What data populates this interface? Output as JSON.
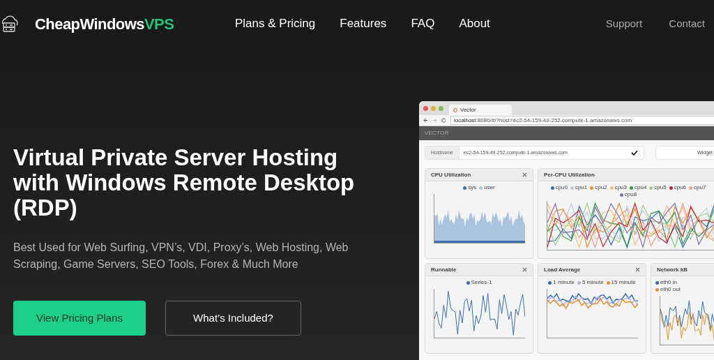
{
  "nav": {
    "logo": {
      "text": "CheapWindows",
      "accent": "VPS"
    },
    "links": [
      {
        "label": "Plans & Pricing"
      },
      {
        "label": "Features"
      },
      {
        "label": "FAQ"
      },
      {
        "label": "About"
      }
    ],
    "right_links": [
      {
        "label": "Support"
      },
      {
        "label": "Contact"
      }
    ]
  },
  "hero": {
    "title": "Virtual Private Server Hosting with Windows Remote Desktop (RDP)",
    "subtitle": "Best Used for Web Surfing, VPN’s, VDI, Proxy’s, Web Hosting, Web Scraping, Game Servers, SEO Tools, Forex & Much More",
    "buttons": [
      {
        "label": "View Pricing Plans",
        "kind": "primary"
      },
      {
        "label": "What’s Included?",
        "kind": "outline"
      }
    ]
  },
  "preview": {
    "tab_title": "Vector",
    "url_host": "localhost",
    "url_rest": ":8080/#/?host=ec2-54-159-49-252.compute-1.amazonaws.com",
    "app_title": "VECTOR",
    "hostname_label": "Hostname",
    "hostname_value": "ec2-54-159-49-252.compute-1.amazonaws.com",
    "widget_button": "Widget",
    "rows": [
      [
        {
          "title": "CPU Utilization",
          "kind": "area",
          "closable": true,
          "legend": [
            {
              "name": "sys",
              "color": "#3b6fb0"
            },
            {
              "name": "user",
              "color": "#a9c3e0"
            }
          ]
        },
        {
          "title": "Per-CPU Utilization",
          "kind": "multi",
          "legend": [
            {
              "name": "cpu0",
              "color": "#2f6db5"
            },
            {
              "name": "cpu1",
              "color": "#b9cde6"
            },
            {
              "name": "cpu2",
              "color": "#e8902a"
            },
            {
              "name": "cpu3",
              "color": "#f2c17c"
            },
            {
              "name": "cpu4",
              "color": "#2e9a3e"
            },
            {
              "name": "cpu5",
              "color": "#9fd08a"
            },
            {
              "name": "cpu6",
              "color": "#c0272d"
            },
            {
              "name": "cpu7",
              "color": "#f2a08a"
            },
            {
              "name": "cpu8",
              "color": "#8b6bb8"
            }
          ]
        }
      ],
      [
        {
          "title": "Runnable",
          "kind": "spiky",
          "closable": true,
          "legend": [
            {
              "name": "Series-1",
              "color": "#3b6fb0"
            }
          ]
        },
        {
          "title": "Load Average",
          "kind": "load",
          "closable": true,
          "legend": [
            {
              "name": "1 minute",
              "color": "#2f6db5"
            },
            {
              "name": "5 minute",
              "color": "#b6b3e6"
            },
            {
              "name": "15 minute",
              "color": "#e8902a"
            }
          ]
        },
        {
          "title": "Network kB",
          "kind": "net",
          "legend": [
            {
              "name": "eth0 in",
              "color": "#2f6db5"
            },
            {
              "name": "eth0 out",
              "color": "#e8902a"
            }
          ]
        }
      ]
    ]
  }
}
